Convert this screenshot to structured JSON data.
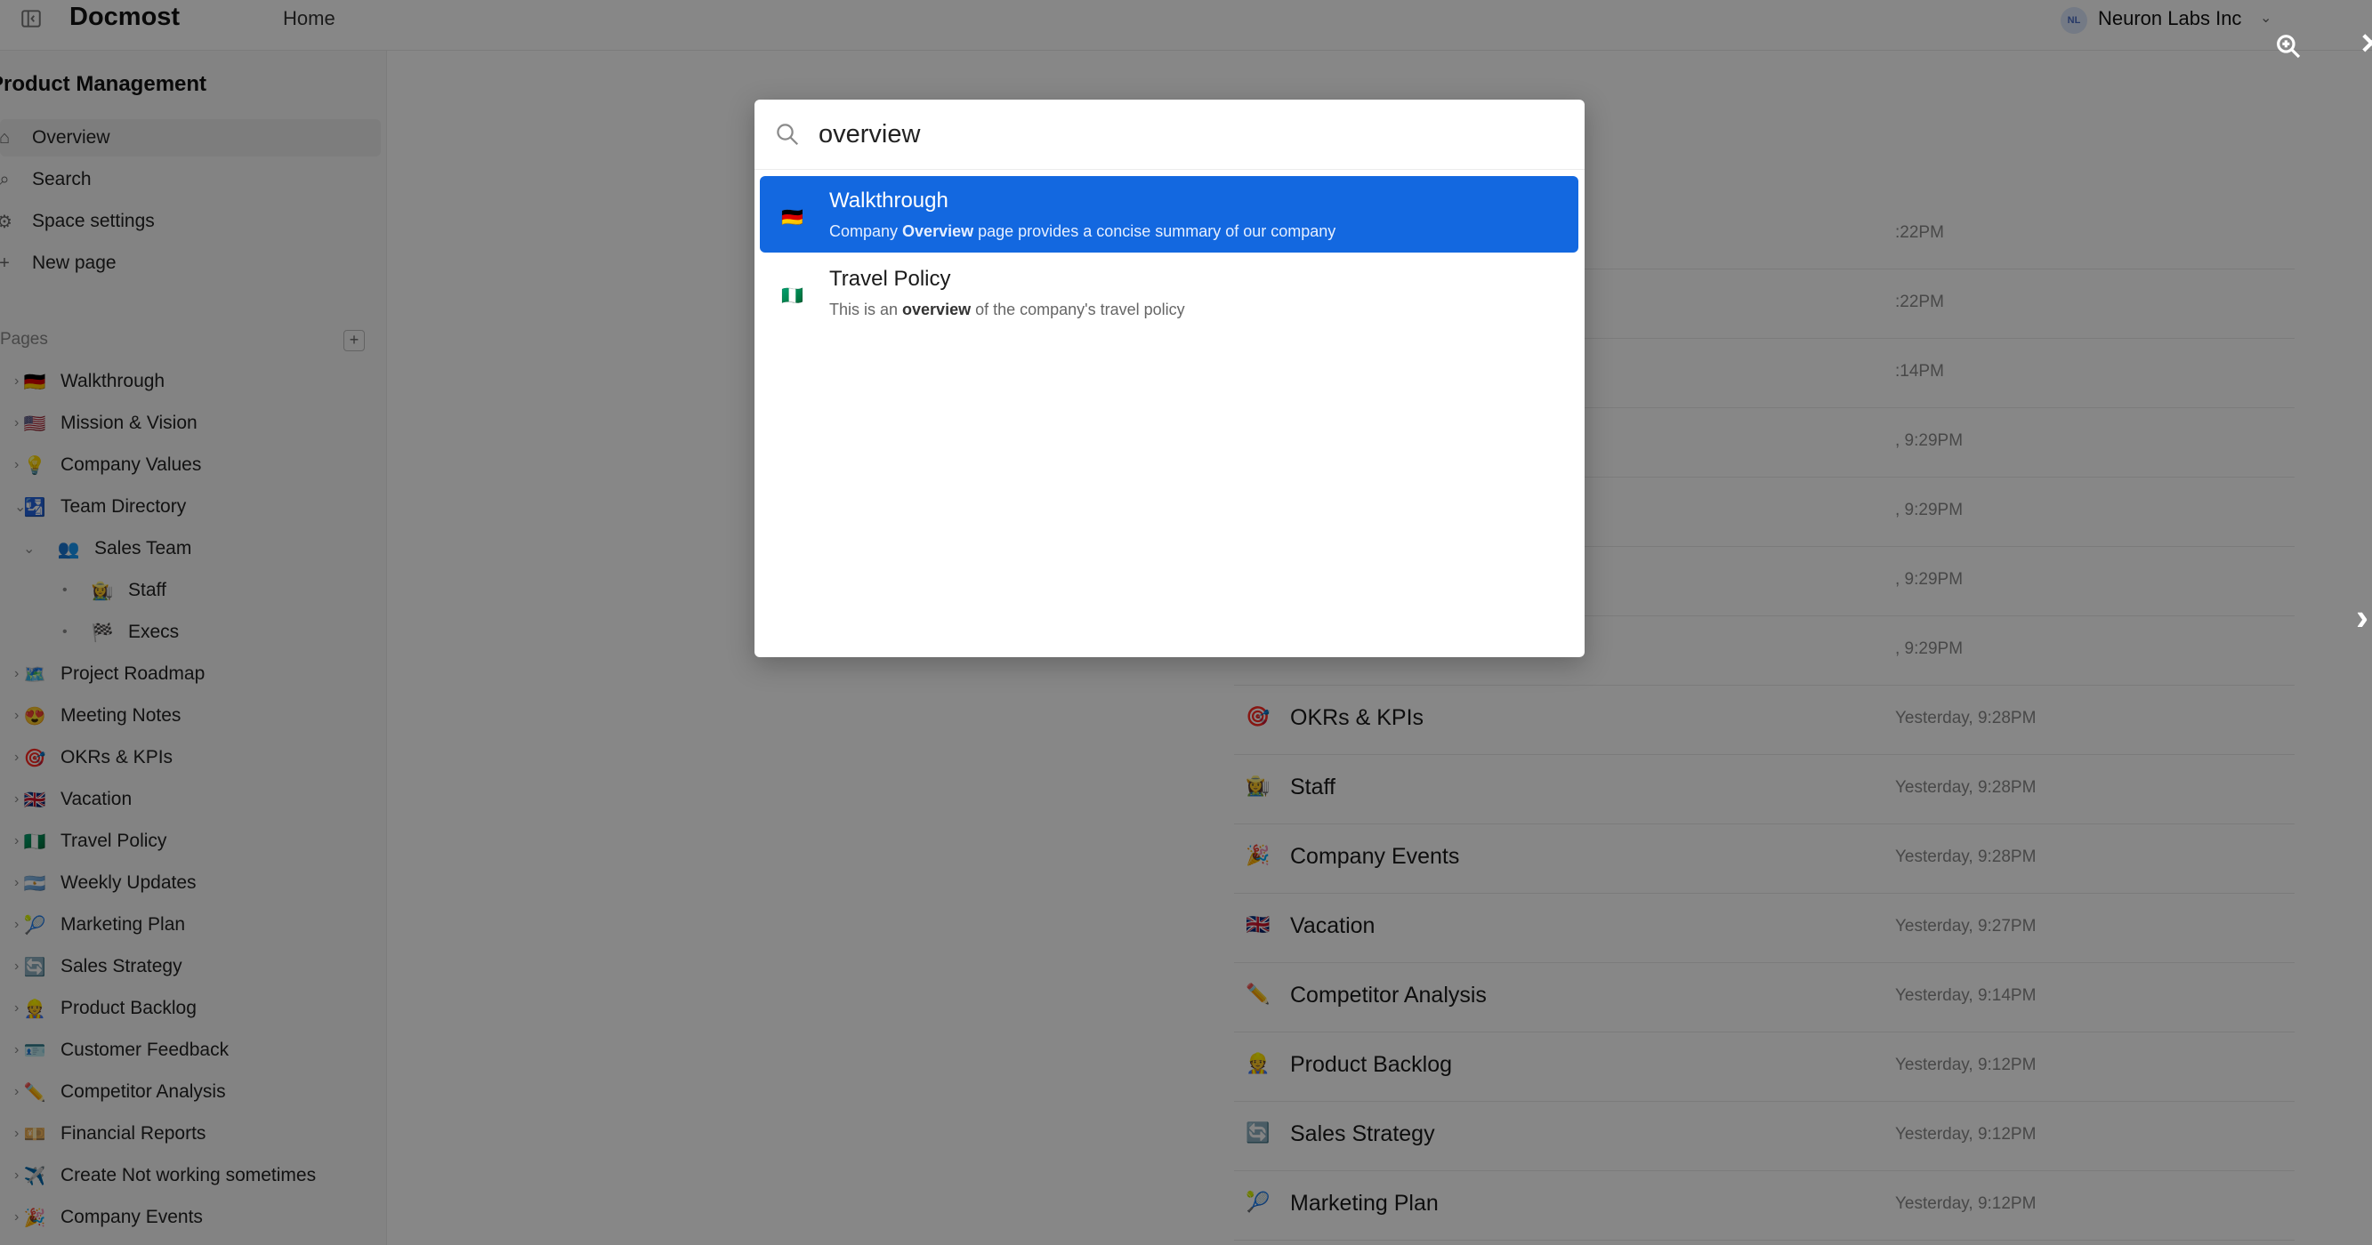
{
  "header": {
    "brand": "Docmost",
    "home": "Home",
    "workspace_initials": "NL",
    "workspace_name": "Neuron Labs Inc"
  },
  "sidebar": {
    "space_title": "Product Management",
    "nav": [
      {
        "label": "Overview",
        "icon": "home-icon"
      },
      {
        "label": "Search",
        "icon": "search-icon"
      },
      {
        "label": "Space settings",
        "icon": "gear-icon"
      },
      {
        "label": "New page",
        "icon": "plus-icon"
      }
    ],
    "pages_label": "Pages",
    "pages": [
      {
        "emoji": "🇩🇪",
        "label": "Walkthrough"
      },
      {
        "emoji": "🇺🇸",
        "label": "Mission & Vision"
      },
      {
        "emoji": "💡",
        "label": "Company Values"
      },
      {
        "emoji": "🛂",
        "label": "Team Directory"
      },
      {
        "emoji": "👥",
        "label": "Sales Team"
      },
      {
        "emoji": "👩‍🌾",
        "label": "Staff"
      },
      {
        "emoji": "🏁",
        "label": "Execs"
      },
      {
        "emoji": "🗺️",
        "label": "Project Roadmap"
      },
      {
        "emoji": "😍",
        "label": "Meeting Notes"
      },
      {
        "emoji": "🎯",
        "label": "OKRs & KPIs"
      },
      {
        "emoji": "🇬🇧",
        "label": "Vacation"
      },
      {
        "emoji": "🇳🇬",
        "label": "Travel Policy"
      },
      {
        "emoji": "🇦🇷",
        "label": "Weekly Updates"
      },
      {
        "emoji": "🎾",
        "label": "Marketing Plan"
      },
      {
        "emoji": "🔄",
        "label": "Sales Strategy"
      },
      {
        "emoji": "👷",
        "label": "Product Backlog"
      },
      {
        "emoji": "🪪",
        "label": "Customer Feedback"
      },
      {
        "emoji": "✏️",
        "label": "Competitor Analysis"
      },
      {
        "emoji": "💴",
        "label": "Financial Reports"
      },
      {
        "emoji": "✈️",
        "label": "Create Not working sometimes"
      },
      {
        "emoji": "🎉",
        "label": "Company Events"
      }
    ]
  },
  "recent": [
    {
      "emoji": "",
      "title": "",
      "date": ":22PM"
    },
    {
      "emoji": "",
      "title": "",
      "date": ":22PM"
    },
    {
      "emoji": "",
      "title": "",
      "date": ":14PM"
    },
    {
      "emoji": "",
      "title": "",
      "date": ", 9:29PM"
    },
    {
      "emoji": "",
      "title": "",
      "date": ", 9:29PM"
    },
    {
      "emoji": "",
      "title": "",
      "date": ", 9:29PM"
    },
    {
      "emoji": "",
      "title": "",
      "date": ", 9:29PM"
    },
    {
      "emoji": "🎯",
      "title": "OKRs & KPIs",
      "date": "Yesterday, 9:28PM"
    },
    {
      "emoji": "👩‍🌾",
      "title": "Staff",
      "date": "Yesterday, 9:28PM"
    },
    {
      "emoji": "🎉",
      "title": "Company Events",
      "date": "Yesterday, 9:28PM"
    },
    {
      "emoji": "🇬🇧",
      "title": "Vacation",
      "date": "Yesterday, 9:27PM"
    },
    {
      "emoji": "✏️",
      "title": "Competitor Analysis",
      "date": "Yesterday, 9:14PM"
    },
    {
      "emoji": "👷",
      "title": "Product Backlog",
      "date": "Yesterday, 9:12PM"
    },
    {
      "emoji": "🔄",
      "title": "Sales Strategy",
      "date": "Yesterday, 9:12PM"
    },
    {
      "emoji": "🎾",
      "title": "Marketing Plan",
      "date": "Yesterday, 9:12PM"
    }
  ],
  "search_modal": {
    "query": "overview",
    "results": [
      {
        "emoji": "🇩🇪",
        "title": "Walkthrough",
        "snippet_before": "Company ",
        "snippet_match": "Overview",
        "snippet_after": " page provides a concise summary of our company"
      },
      {
        "emoji": "🇳🇬",
        "title": "Travel Policy",
        "snippet_before": "This is an ",
        "snippet_match": "overview",
        "snippet_after": " of the company's travel policy"
      }
    ]
  },
  "colors": {
    "accent": "#1368e0",
    "overlay": "rgba(0,0,0,0.47)",
    "sidebar_bg": "#f7f7f7"
  }
}
